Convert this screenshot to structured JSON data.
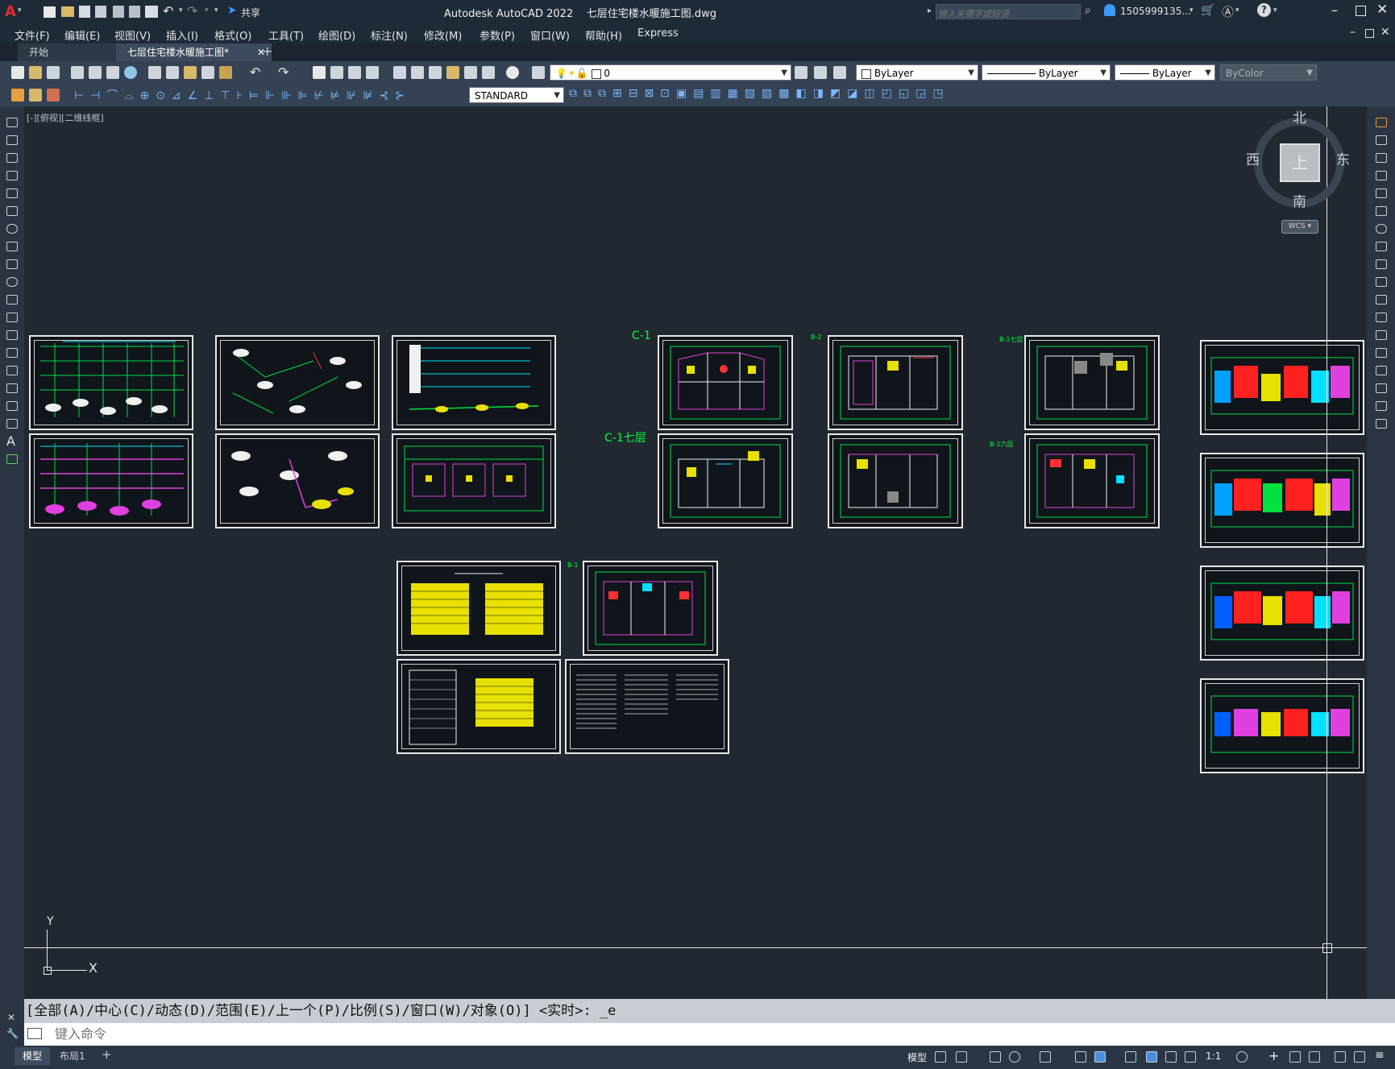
{
  "app": {
    "title": "Autodesk AutoCAD 2022    七层住宅楼水暖施工图.dwg",
    "share_label": "共享",
    "search_placeholder": "键入关键字或短语",
    "user": "1505999135...",
    "brand_color": "#e82a2a"
  },
  "menu": [
    "文件(F)",
    "编辑(E)",
    "视图(V)",
    "插入(I)",
    "格式(O)",
    "工具(T)",
    "绘图(D)",
    "标注(N)",
    "修改(M)",
    "参数(P)",
    "窗口(W)",
    "帮助(H)",
    "Express"
  ],
  "tabs": [
    {
      "label": "开始",
      "active": false
    },
    {
      "label": "七层住宅楼水暖施工图*",
      "active": true
    }
  ],
  "toolbar1": {
    "layer": "0",
    "color": "ByLayer",
    "linetype": "ByLayer",
    "lineweight": "ByLayer",
    "plotstyle": "ByColor"
  },
  "toolbar2": {
    "textstyle": "STANDARD"
  },
  "viewport": {
    "label": "[-][俯视][二维线框]",
    "viewcube": {
      "north": "北",
      "south": "南",
      "east": "东",
      "west": "西",
      "face": "上",
      "wcs": "WCS"
    },
    "ucs": {
      "x": "X",
      "y": "Y"
    }
  },
  "drawing_labels": {
    "c1": "C-1",
    "c1_7": "C-1七层",
    "b2": "B-2",
    "b1_7": "B-1七层",
    "b1_6": "B-1六层",
    "b1": "B-1"
  },
  "command": {
    "history": "[全部(A)/中心(C)/动态(D)/范围(E)/上一个(P)/比例(S)/窗口(W)/对象(O)] <实时>: _e",
    "placeholder": "键入命令"
  },
  "status": {
    "tabs": [
      "模型",
      "布局1"
    ],
    "model_label": "模型",
    "scale": "1:1"
  }
}
